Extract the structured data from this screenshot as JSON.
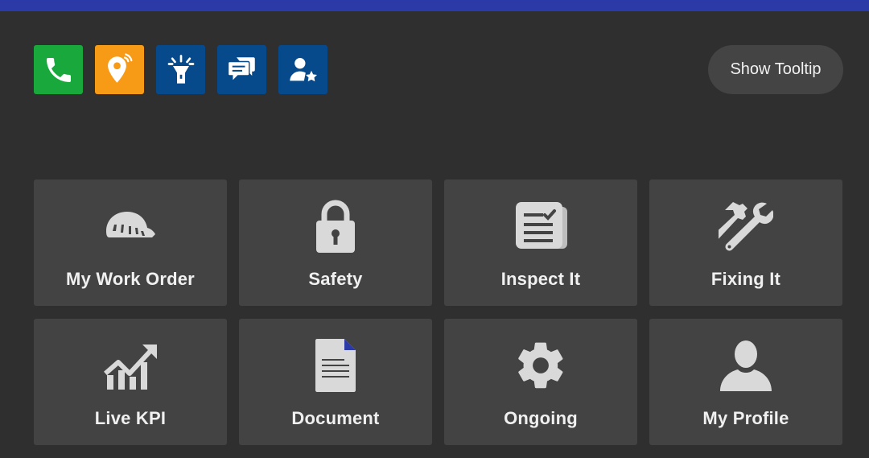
{
  "colors": {
    "topbar": "#2b3aa6",
    "background": "#2f2f2f",
    "tile": "#434343",
    "icon": "#d9d9d9",
    "call": "#18a83c",
    "location": "#f79b16",
    "blue": "#074a8c"
  },
  "quick_actions": [
    {
      "icon": "phone-icon",
      "color": "#18a83c"
    },
    {
      "icon": "location-pin-icon",
      "color": "#f79b16"
    },
    {
      "icon": "flashlight-icon",
      "color": "#074a8c"
    },
    {
      "icon": "chat-bubbles-icon",
      "color": "#074a8c"
    },
    {
      "icon": "user-star-icon",
      "color": "#074a8c"
    }
  ],
  "tooltip_button": {
    "label": "Show Tooltip"
  },
  "tiles": [
    {
      "label": "My Work Order",
      "icon": "hard-hat-icon"
    },
    {
      "label": "Safety",
      "icon": "padlock-icon"
    },
    {
      "label": "Inspect It",
      "icon": "checklist-icon"
    },
    {
      "label": "Fixing It",
      "icon": "tools-icon"
    },
    {
      "label": "Live KPI",
      "icon": "growth-chart-icon"
    },
    {
      "label": "Document",
      "icon": "document-icon"
    },
    {
      "label": "Ongoing",
      "icon": "gear-icon"
    },
    {
      "label": "My Profile",
      "icon": "user-icon"
    }
  ]
}
